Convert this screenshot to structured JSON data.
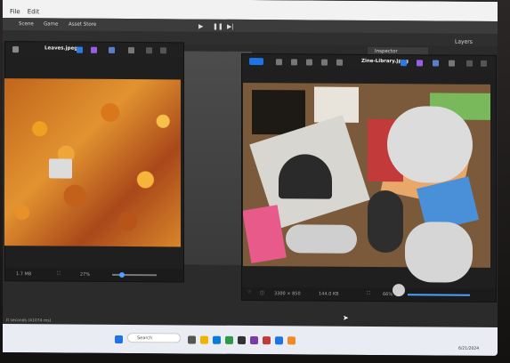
{
  "window": {
    "menu": [
      "File",
      "Edit"
    ]
  },
  "unity": {
    "tabs": [
      "Scene",
      "Game",
      "Asset Store"
    ],
    "inspector": "Inspector",
    "layers": "Layers"
  },
  "viewer_left": {
    "filename": "Leaves.jpeg",
    "footer_size": "1.7 MB",
    "zoom": "27%"
  },
  "viewer_right": {
    "filename": "Zine-Library.jpeg",
    "footer_dims": "3300 × 850",
    "footer_size": "144.0 KB",
    "zoom": "66%"
  },
  "status": {
    "text": "It seconds (41074 ms)"
  },
  "taskbar": {
    "search_placeholder": "Search",
    "clock": "6/21/2024"
  },
  "colors": {
    "accent": "#1e73e8",
    "leaves_orange": "#e08a2a",
    "folder_blue": "#4a90d9"
  }
}
